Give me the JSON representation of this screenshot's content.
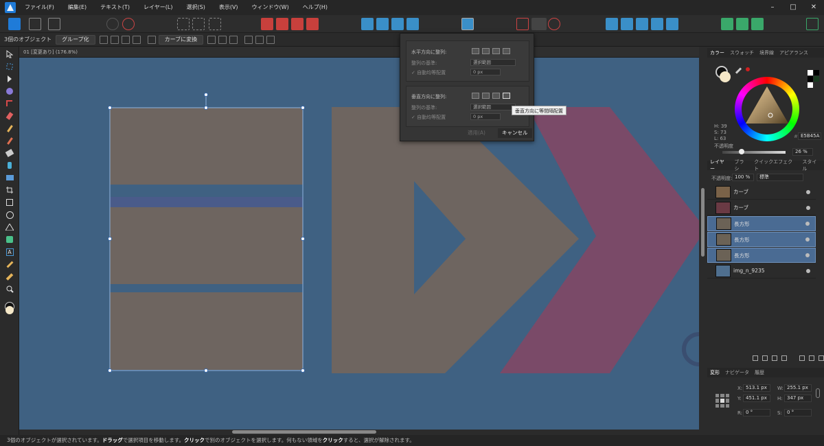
{
  "menubar": {
    "items": [
      "ファイル(F)",
      "編集(E)",
      "テキスト(T)",
      "レイヤー(L)",
      "選択(S)",
      "表示(V)",
      "ウィンドウ(W)",
      "ヘルプ(H)"
    ]
  },
  "context_toolbar": {
    "selection_label": "3個のオブジェクト",
    "group_button": "グループ化",
    "convert_curve_button": "カーブに変換"
  },
  "document": {
    "tab_title": "01 [変更あり] (176.8%)"
  },
  "align_popup": {
    "horizontal_label": "水平方向に整列:",
    "horizontal_basis_label": "整列の基準:",
    "horizontal_basis_value": "選択範囲",
    "horizontal_auto_label": "自動均等配置",
    "horizontal_px": "0 px",
    "vertical_label": "垂直方向に整列:",
    "vertical_basis_label": "整列の基準:",
    "vertical_basis_value": "選択範囲",
    "vertical_auto_label": "自動均等配置",
    "vertical_px": "0 px",
    "apply_button": "適用(A)",
    "cancel_button": "キャンセル",
    "tooltip": "垂直方向に等間隔配置"
  },
  "color_panel": {
    "tabs": [
      "カラー",
      "スウォッチ",
      "境界線",
      "アピアランス"
    ],
    "h": "H: 39",
    "s": "S: 73",
    "l": "L: 63",
    "hex": "E5B45A",
    "opacity_label": "不透明度",
    "opacity_value": "26 %"
  },
  "layers_panel": {
    "tabs": [
      "レイヤー",
      "ブラシ",
      "クイックエフェクト",
      "スタイル"
    ],
    "opacity_label": "不透明度:",
    "opacity_value": "100 %",
    "blend_mode": "標準",
    "layers": [
      {
        "name": "カーブ",
        "selected": false,
        "thumb": "#7a6248"
      },
      {
        "name": "カーブ",
        "selected": false,
        "thumb": "#6a3a44"
      },
      {
        "name": "長方形",
        "selected": true,
        "thumb": "#6b6256"
      },
      {
        "name": "長方形",
        "selected": true,
        "thumb": "#6b6256"
      },
      {
        "name": "長方形",
        "selected": true,
        "thumb": "#6b6256"
      },
      {
        "name": "img_n_9235",
        "selected": false,
        "thumb": "#4f6f8f"
      }
    ]
  },
  "transform_panel": {
    "tabs": [
      "変形",
      "ナビゲータ",
      "履歴"
    ],
    "x_label": "X:",
    "x": "513.1 px",
    "y_label": "Y:",
    "y": "451.1 px",
    "w_label": "W:",
    "w": "255.1 px",
    "h_label": "H:",
    "h": "347 px",
    "r_label": "R:",
    "r": "0 °",
    "s_label": "S:",
    "s": "0 °"
  },
  "status": {
    "t1": "3個のオブジェクトが選択されています。",
    "drag": "ドラッグ",
    "t2": "で選択項目を移動します。",
    "click": "クリック",
    "t3": "で別のオブジェクトを選択します。何もない領域を",
    "click2": "クリック",
    "t4": "すると、選択が解除されます。"
  },
  "colors": {
    "canvas_bg": "#3f6182",
    "shape_fill": "#6e6560",
    "chevron_pink": "#7a4a68",
    "selection_blue": "#4a6b93",
    "accent_swatch": "#e5b45a"
  }
}
